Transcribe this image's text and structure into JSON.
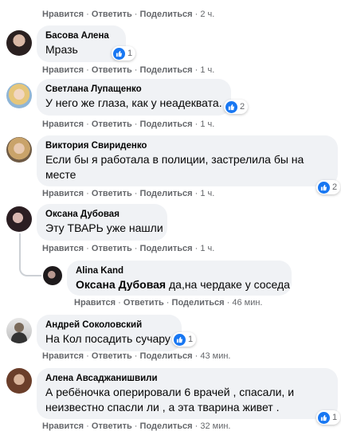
{
  "action_labels": {
    "like": "Нравится",
    "reply": "Ответить",
    "share": "Поделиться",
    "sep": "·"
  },
  "colors": {
    "like_blue": "#1877f2",
    "bubble": "#f0f2f5",
    "meta": "#65676b"
  },
  "comments": [
    {
      "time": "2 ч."
    },
    {
      "author": "Басова Алена",
      "text": "Мразь",
      "reactions": "1",
      "time": "1 ч.",
      "avatar": "avatar-woman-dark-hair"
    },
    {
      "author": "Светлана Лупащенко",
      "text": "У него же глаза, как у неадеквата.",
      "reactions": "2",
      "time": "1 ч.",
      "avatar": "avatar-woman-blonde"
    },
    {
      "author": "Виктория Свириденко",
      "text_lines": [
        "Если бы я работала в полиции, застрелила бы на",
        "месте"
      ],
      "reactions": "2",
      "time": "1 ч.",
      "avatar": "avatar-woman-curly"
    },
    {
      "author": "Оксана Дубовая",
      "text": "Эту ТВАРЬ уже нашли",
      "time": "1 ч.",
      "avatar": "avatar-woman-dark"
    },
    {
      "author": "Alina Kand",
      "reply_to": "Оксана Дубовая",
      "text": " да,на чердаке у соседа",
      "time": "46 мин.",
      "avatar": "avatar-woman-dark-small"
    },
    {
      "author": "Андрей Соколовский",
      "text": "На Кол посадить сучару",
      "reactions": "1",
      "time": "43 мин.",
      "avatar": "avatar-man"
    },
    {
      "author": "Алена Авсаджанишвили",
      "text_lines": [
        "А ребёночка оперировали 6 врачей , спасали, и",
        "неизвестно спасли ли , а эта тварина живет ."
      ],
      "reactions": "1",
      "time": "32 мин.",
      "avatar": "avatar-woman-brown"
    }
  ]
}
